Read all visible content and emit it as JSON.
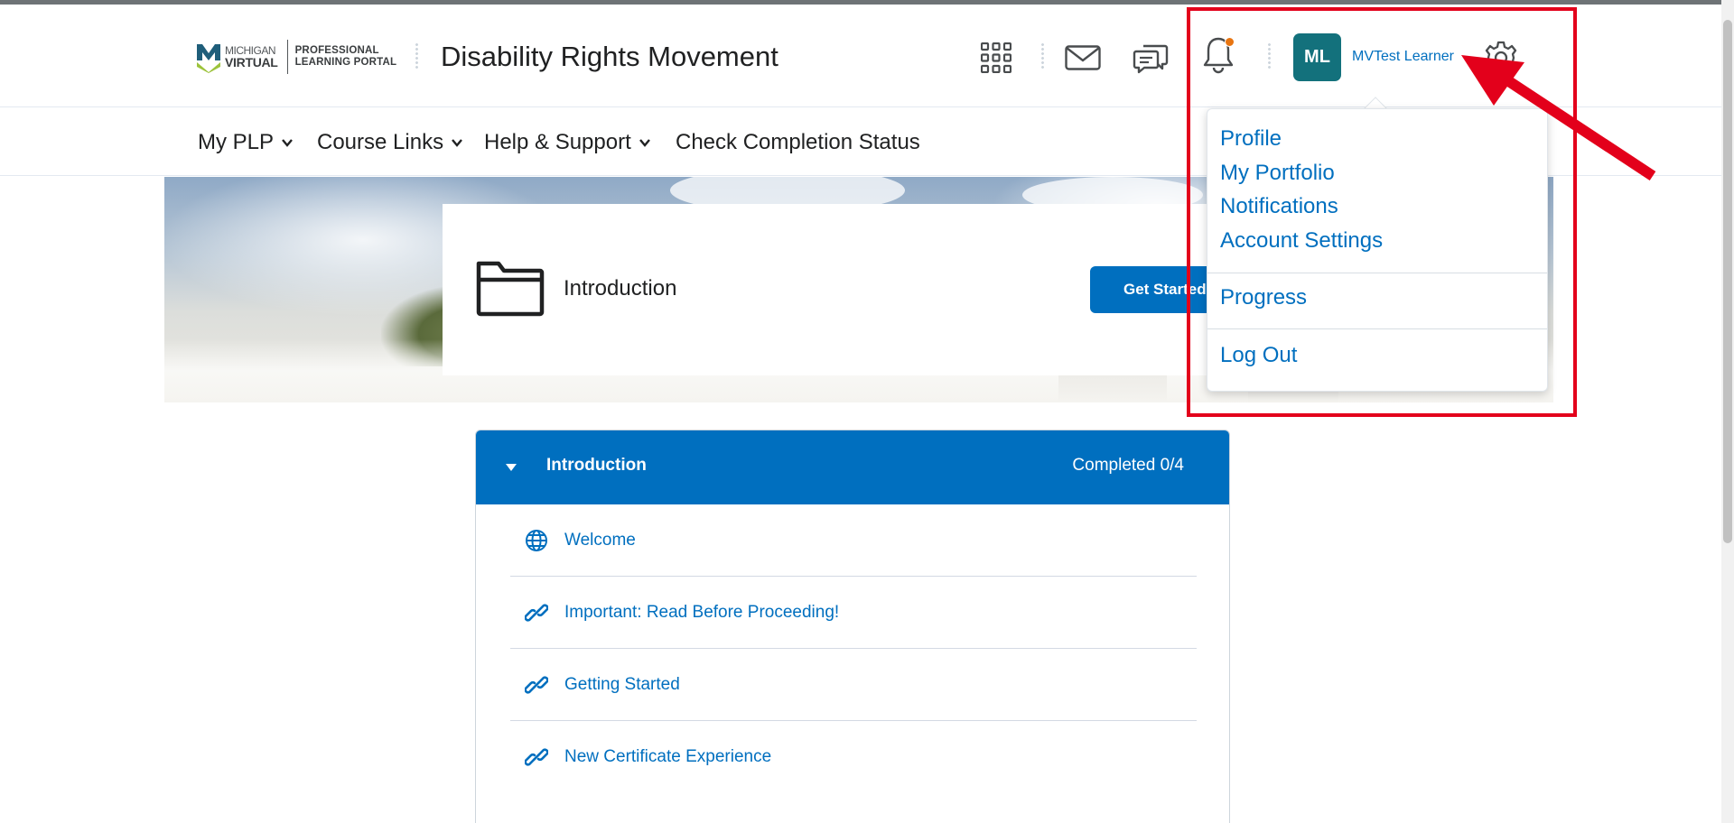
{
  "header": {
    "logo": {
      "line1": "MICHIGAN",
      "line2": "VIRTUAL",
      "portal_line1": "PROFESSIONAL",
      "portal_line2": "LEARNING PORTAL"
    },
    "course_title": "Disability Rights Movement",
    "icons": [
      "grid-icon",
      "mail-icon",
      "chat-icon",
      "bell-icon",
      "gear-icon"
    ],
    "notification_badge_color": "#e87511",
    "avatar_initials": "ML",
    "avatar_color": "#13717c",
    "user_name": "MVTest Learner"
  },
  "nav": {
    "items": [
      {
        "label": "My PLP",
        "has_dropdown": true
      },
      {
        "label": "Course Links",
        "has_dropdown": true
      },
      {
        "label": "Help & Support",
        "has_dropdown": true
      },
      {
        "label": "Check Completion Status",
        "has_dropdown": false
      }
    ]
  },
  "banner": {
    "card_title": "Introduction",
    "button_label": "Get Started"
  },
  "module": {
    "title": "Introduction",
    "status": "Completed 0/4",
    "topics": [
      {
        "label": "Welcome",
        "icon": "globe-icon"
      },
      {
        "label": "Important: Read Before Proceeding!",
        "icon": "link-icon"
      },
      {
        "label": "Getting Started",
        "icon": "link-icon"
      },
      {
        "label": "New Certificate Experience",
        "icon": "link-icon"
      }
    ]
  },
  "user_menu": {
    "group1": [
      "Profile",
      "My Portfolio",
      "Notifications",
      "Account Settings"
    ],
    "group2": [
      "Progress"
    ],
    "group3": [
      "Log Out"
    ]
  },
  "colors": {
    "accent": "#006fbf",
    "annotation": "#e3001b"
  }
}
